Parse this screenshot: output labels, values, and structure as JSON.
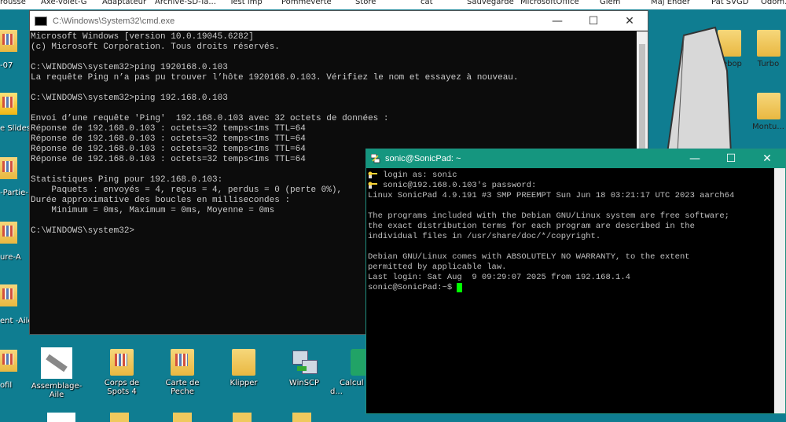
{
  "desktop": {
    "top_labels": [
      "rousse",
      "Axe-volet-G",
      "Adaptateur",
      "Archive-SD-Ta...",
      "Test imp",
      "Pommeverte",
      "Store",
      "cat",
      "Sauvegarde",
      "MicrosoftOffice",
      "Glem",
      "Maj Ender",
      "Pat SVGD",
      "Odom..."
    ],
    "left_labels": [
      "-07",
      "e Slides",
      "-Partie-1",
      "ure-A",
      "ent -Aile",
      "ofil"
    ],
    "bottom_icons": [
      "Assemblage-Aile",
      "Corps de Spots 4",
      "Carte de Peche",
      "Klipper",
      "WinSCP",
      "Calcul d..."
    ],
    "right_icons": [
      "Bebop",
      "Turbo",
      "Montu..."
    ]
  },
  "cmd": {
    "title": "C:\\Windows\\System32\\cmd.exe",
    "minimize": "—",
    "maximize": "☐",
    "close": "✕",
    "lines": [
      "Microsoft Windows [version 10.0.19045.6282]",
      "(c) Microsoft Corporation. Tous droits réservés.",
      "",
      "C:\\WINDOWS\\system32>ping 1920168.0.103",
      "La requête Ping n’a pas pu trouver l’hôte 1920168.0.103. Vérifiez le nom et essayez à nouveau.",
      "",
      "C:\\WINDOWS\\system32>ping 192.168.0.103",
      "",
      "Envoi d’une requête 'Ping'  192.168.0.103 avec 32 octets de données :",
      "Réponse de 192.168.0.103 : octets=32 temps<1ms TTL=64",
      "Réponse de 192.168.0.103 : octets=32 temps<1ms TTL=64",
      "Réponse de 192.168.0.103 : octets=32 temps<1ms TTL=64",
      "Réponse de 192.168.0.103 : octets=32 temps<1ms TTL=64",
      "",
      "Statistiques Ping pour 192.168.0.103:",
      "    Paquets : envoyés = 4, reçus = 4, perdus = 0 (perte 0%),",
      "Durée approximative des boucles en millisecondes :",
      "    Minimum = 0ms, Maximum = 0ms, Moyenne = 0ms",
      "",
      "C:\\WINDOWS\\system32>"
    ]
  },
  "putty": {
    "title": "sonic@SonicPad: ~",
    "minimize": "—",
    "maximize": "☐",
    "close": "✕",
    "lines": [
      "login as: sonic",
      "sonic@192.168.0.103's password:",
      "Linux SonicPad 4.9.191 #3 SMP PREEMPT Sun Jun 18 03:21:17 UTC 2023 aarch64",
      "",
      "The programs included with the Debian GNU/Linux system are free software;",
      "the exact distribution terms for each program are described in the",
      "individual files in /usr/share/doc/*/copyright.",
      "",
      "Debian GNU/Linux comes with ABSOLUTELY NO WARRANTY, to the extent",
      "permitted by applicable law.",
      "Last login: Sat Aug  9 09:29:07 2025 from 192.168.1.4",
      "sonic@SonicPad:~$ "
    ]
  }
}
